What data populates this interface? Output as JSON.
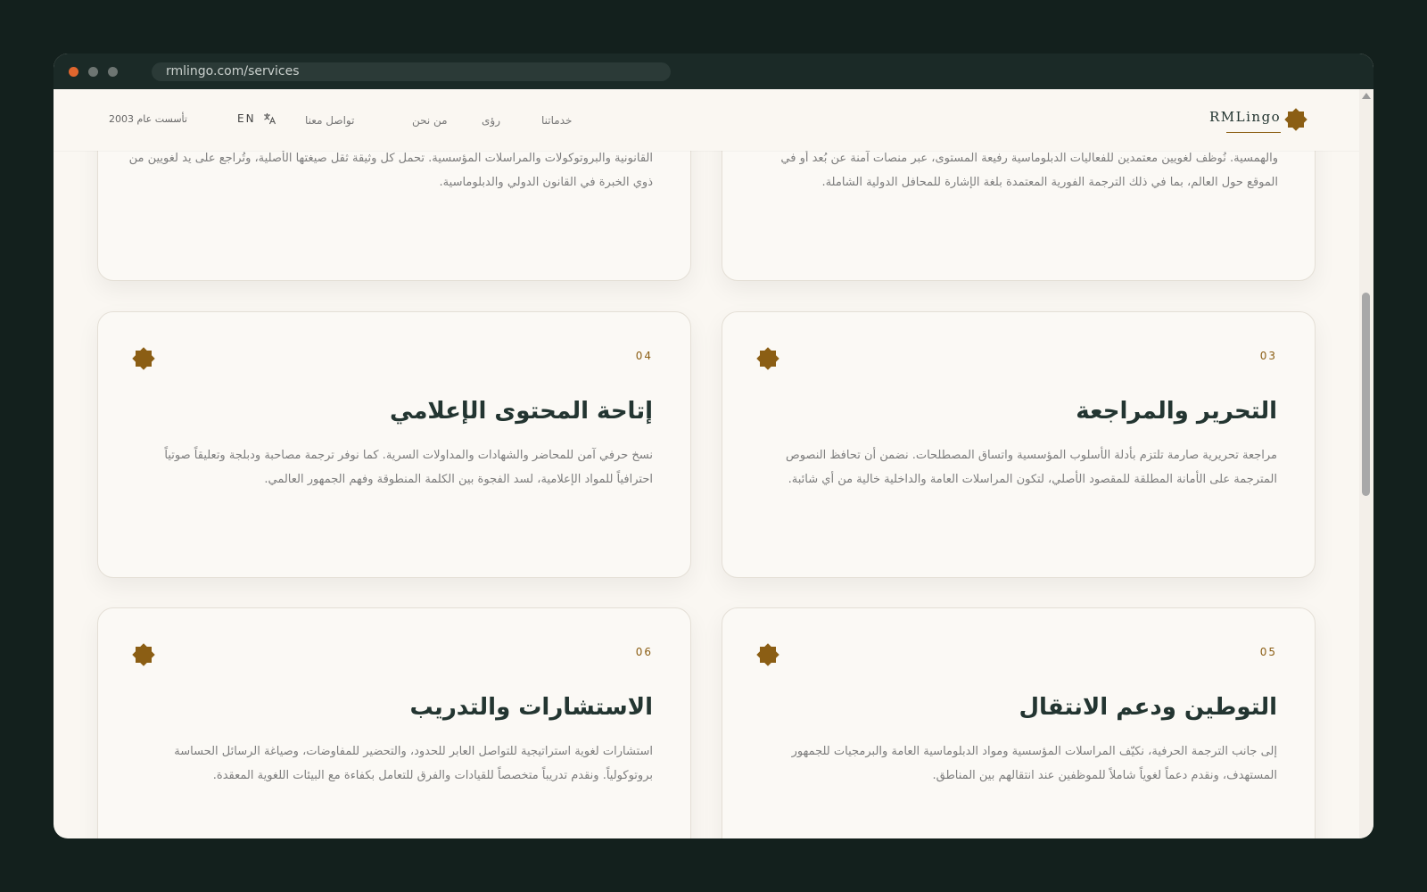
{
  "browser": {
    "url": "rmlingo.com/services"
  },
  "nav": {
    "brand": "RMLingo",
    "links": {
      "services": "خدماتنا",
      "insights": "رؤى",
      "about": "من نحن",
      "contact": "تواصل معنا"
    },
    "language": "EN",
    "founded": "تأسست عام 2003"
  },
  "colors": {
    "accent": "#8b5e14",
    "heading": "#233531",
    "page_bg": "#faf7f2",
    "chrome": "#1b2a27"
  },
  "partial_cards": [
    {
      "text": "والهمسية. نُوظف لغويين معتمدين للفعاليات الدبلوماسية رفيعة المستوى، عبر منصات آمنة عن بُعد أو في الموقع حول العالم، بما في ذلك الترجمة الفورية المعتمدة بلغة الإشارة للمحافل الدولية الشاملة."
    },
    {
      "text": "القانونية والبروتوكولات والمراسلات المؤسسية. تحمل كل وثيقة ثقل صيغتها الأصلية، وتُراجع على يد لغويين من ذوي الخبرة في القانون الدولي والدبلوماسية."
    }
  ],
  "cards": [
    {
      "number": "03",
      "title": "التحرير والمراجعة",
      "description": "مراجعة تحريرية صارمة تلتزم بأدلة الأسلوب المؤسسية واتساق المصطلحات. نضمن أن تحافظ النصوص المترجمة على الأمانة المطلقة للمقصود الأصلي، لتكون المراسلات العامة والداخلية خالية من أي شائبة."
    },
    {
      "number": "04",
      "title": "إتاحة المحتوى الإعلامي",
      "description": "نسخ حرفي آمن للمحاضر والشهادات والمداولات السرية. كما نوفر ترجمة مصاحبة ودبلجة وتعليقاً صوتياً احترافياً للمواد الإعلامية، لسد الفجوة بين الكلمة المنطوقة وفهم الجمهور العالمي."
    },
    {
      "number": "05",
      "title": "التوطين ودعم الانتقال",
      "description": "إلى جانب الترجمة الحرفية، نكيّف المراسلات المؤسسية ومواد الدبلوماسية العامة والبرمجيات للجمهور المستهدف، ونقدم دعماً لغوياً شاملاً للموظفين عند انتقالهم بين المناطق."
    },
    {
      "number": "06",
      "title": "الاستشارات والتدريب",
      "description": "استشارات لغوية استراتيجية للتواصل العابر للحدود، والتحضير للمفاوضات، وصياغة الرسائل الحساسة بروتوكولياً. ونقدم تدريباً متخصصاً للقيادات والفرق للتعامل بكفاءة مع البيئات اللغوية المعقدة."
    }
  ],
  "icons": {
    "card": "eight-point-star-icon",
    "language": "translate-icon"
  }
}
